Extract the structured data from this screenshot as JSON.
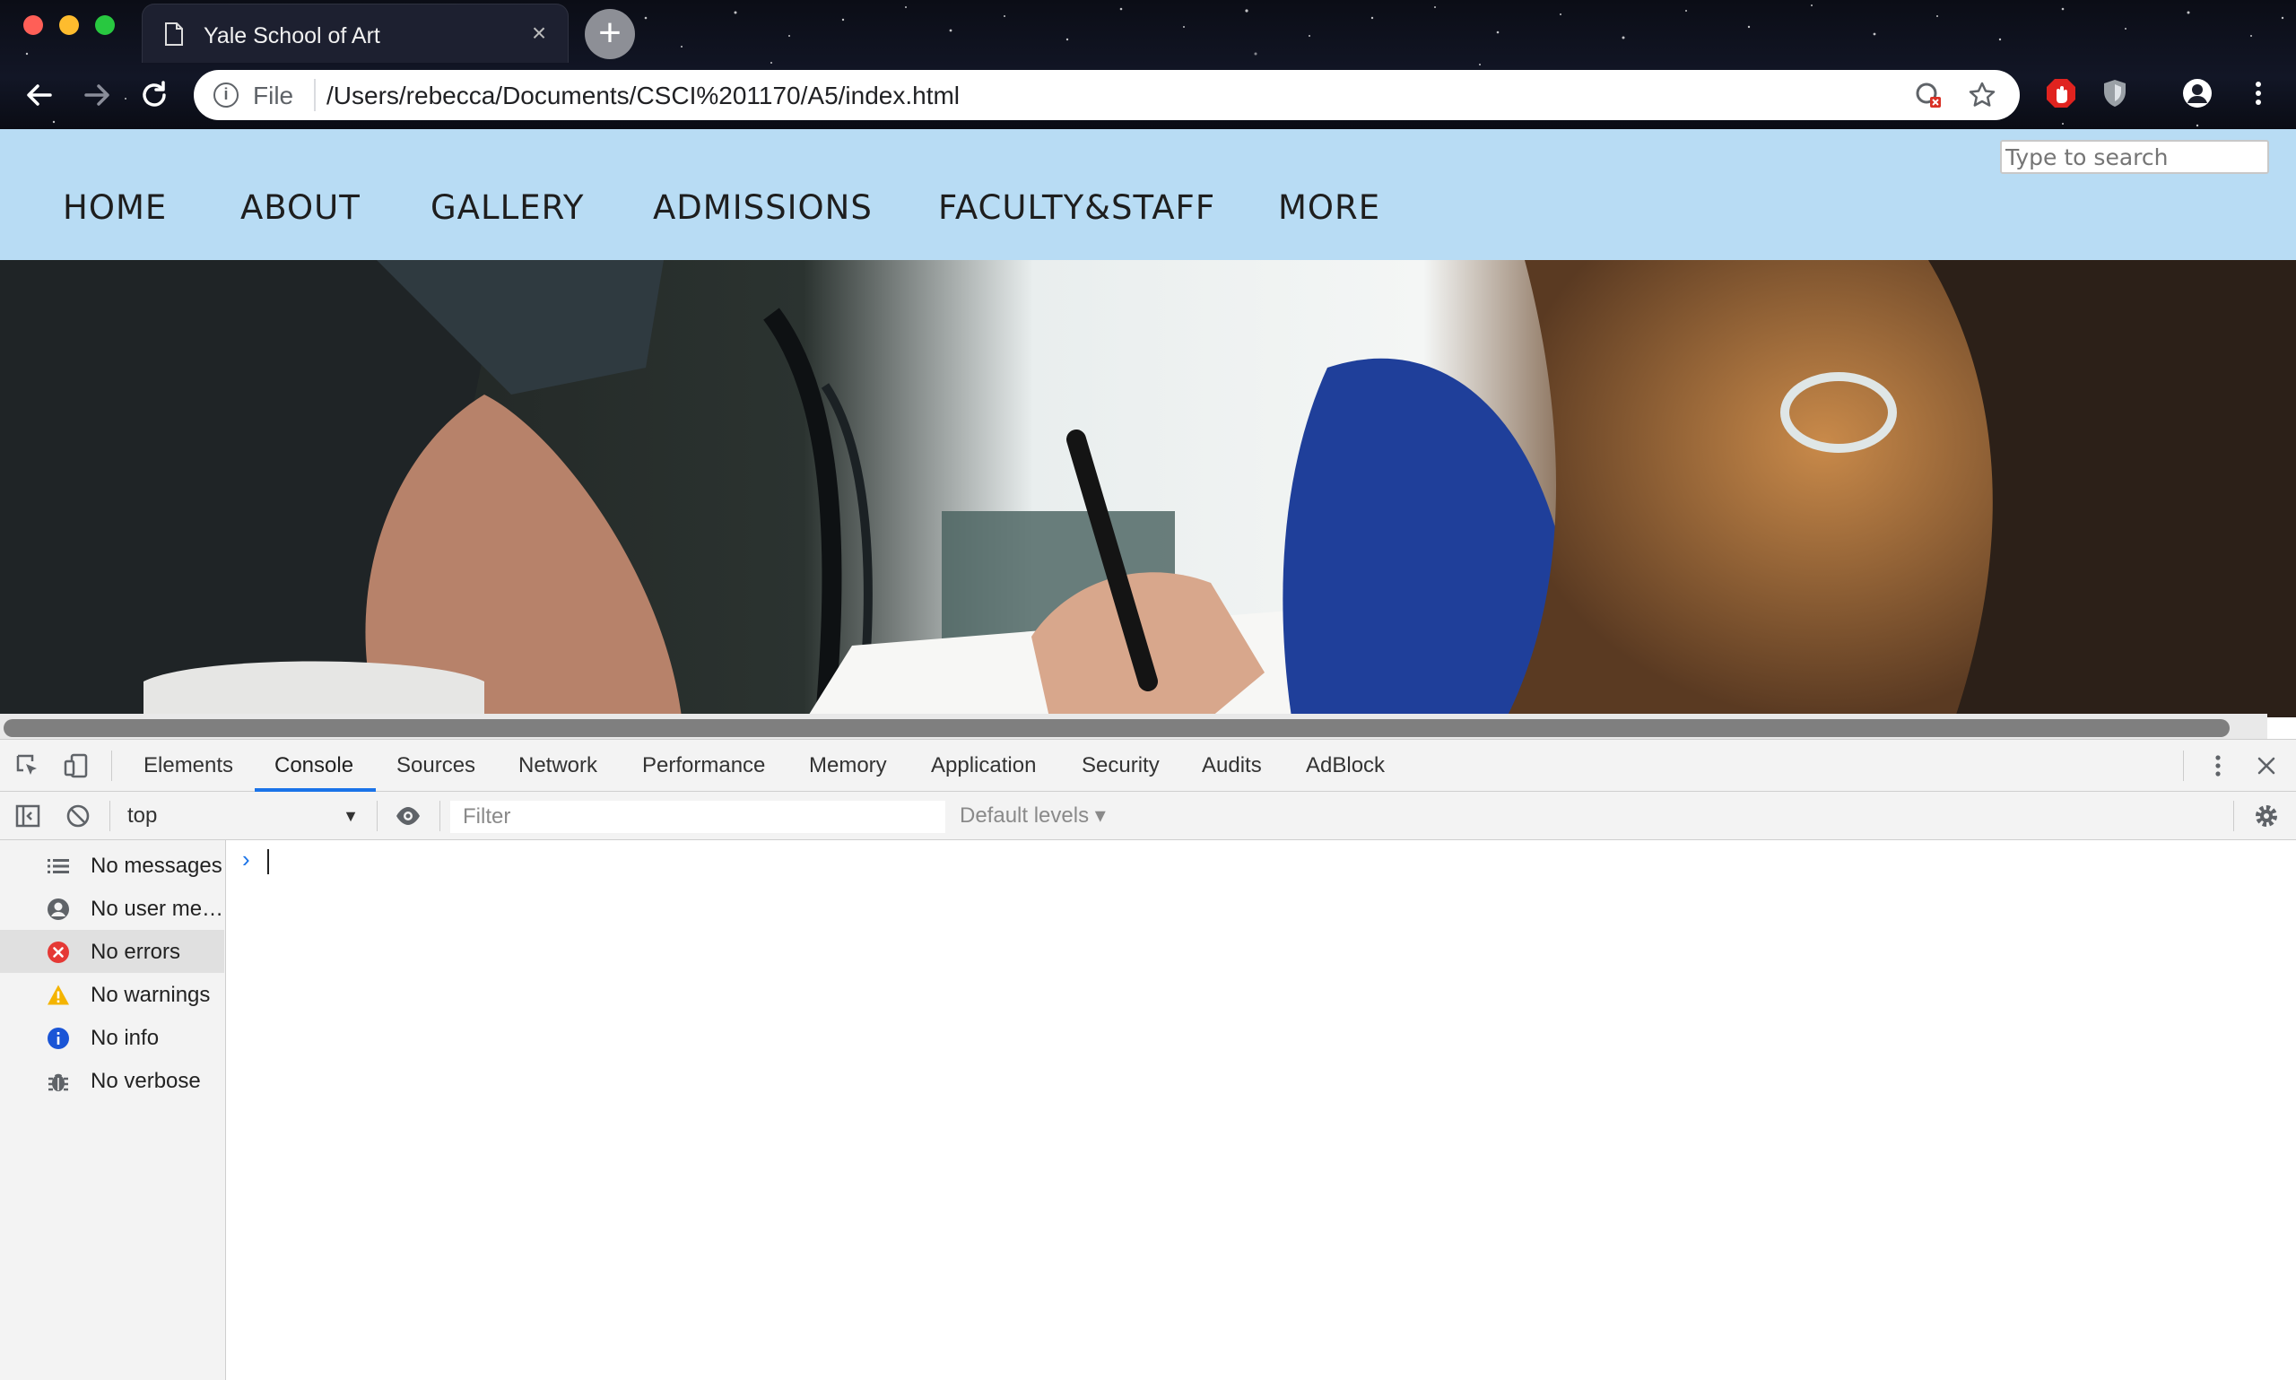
{
  "browser": {
    "tab_title": "Yale School of Art",
    "url_scheme_label": "File",
    "url": "/Users/rebecca/Documents/CSCI%201170/A5/index.html",
    "new_tab_symbol": "+",
    "tab_close_symbol": "×"
  },
  "site": {
    "search_placeholder": "Type to search",
    "nav": [
      "HOME",
      "ABOUT",
      "GALLERY",
      "ADMISSIONS",
      "FACULTY&STAFF",
      "MORE"
    ],
    "header_bg": "#b8dcf4"
  },
  "devtools": {
    "tabs": [
      "Elements",
      "Console",
      "Sources",
      "Network",
      "Performance",
      "Memory",
      "Application",
      "Security",
      "Audits",
      "AdBlock"
    ],
    "active_tab": "Console",
    "context": "top",
    "filter_placeholder": "Filter",
    "levels": "Default levels ▾",
    "sidebar": [
      {
        "label": "No messages",
        "icon": "list-icon"
      },
      {
        "label": "No user me…",
        "icon": "user-icon"
      },
      {
        "label": "No errors",
        "icon": "error-icon",
        "selected": true
      },
      {
        "label": "No warnings",
        "icon": "warning-icon"
      },
      {
        "label": "No info",
        "icon": "info-icon"
      },
      {
        "label": "No verbose",
        "icon": "bug-icon"
      }
    ],
    "prompt_symbol": "›",
    "accent": "#1a73e8"
  }
}
